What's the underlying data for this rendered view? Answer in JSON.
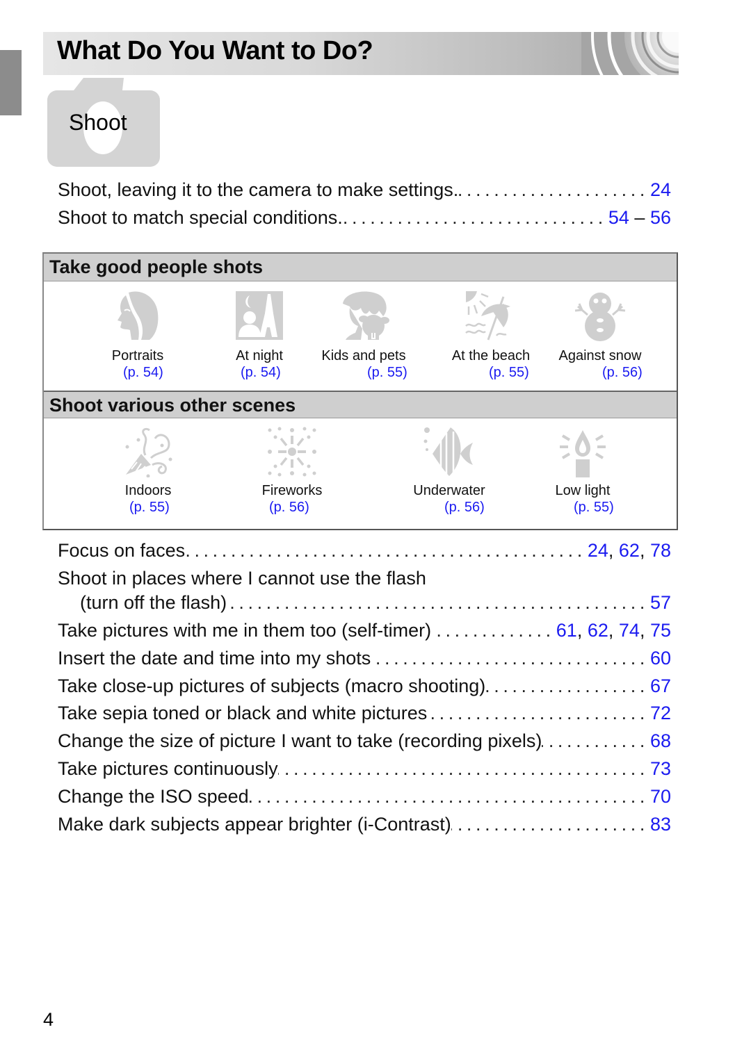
{
  "page": {
    "title": "What Do You Want to Do?",
    "section_label": "Shoot",
    "page_number": "4",
    "link_color": "#1a1af0",
    "header_gray": "#cfcfcf"
  },
  "intro_items": [
    {
      "label": "Shoot, leaving it to the camera to make settings.",
      "pages": [
        "24"
      ],
      "separator": ""
    },
    {
      "label": "Shoot to match special conditions.",
      "pages": [
        "54",
        "56"
      ],
      "separator": " – "
    }
  ],
  "people_shots": {
    "heading": "Take good people shots",
    "items": [
      {
        "name": "Portraits",
        "page": "(p. 54)",
        "icon": "portrait-icon"
      },
      {
        "name": "At night",
        "page": "(p. 54)",
        "icon": "night-scene-icon"
      },
      {
        "name": "Kids and pets",
        "page": "(p. 55)",
        "icon": "kids-pets-icon"
      },
      {
        "name": "At the beach",
        "page": "(p. 55)",
        "icon": "beach-icon"
      },
      {
        "name": "Against snow",
        "page": "(p. 56)",
        "icon": "snowman-icon"
      }
    ]
  },
  "other_scenes": {
    "heading": "Shoot various other scenes",
    "items": [
      {
        "name": "Indoors",
        "page": "(p. 55)",
        "icon": "party-indoors-icon"
      },
      {
        "name": "Fireworks",
        "page": "(p. 56)",
        "icon": "fireworks-icon"
      },
      {
        "name": "Underwater",
        "page": "(p. 56)",
        "icon": "fish-underwater-icon"
      },
      {
        "name": "Low light",
        "page": "(p. 55)",
        "icon": "candle-low-light-icon"
      }
    ]
  },
  "feature_items": [
    {
      "label": "Focus on faces",
      "pages": [
        "24",
        "62",
        "78"
      ]
    },
    {
      "label": "Shoot in places where I cannot use the flash",
      "continuation": "(turn off the flash)",
      "pages": [
        "57"
      ]
    },
    {
      "label": "Take pictures with me in them too (self-timer)",
      "pages": [
        "61",
        "62",
        "74",
        "75"
      ]
    },
    {
      "label": "Insert the date and time into my shots",
      "pages": [
        "60"
      ]
    },
    {
      "label": "Take close-up pictures of subjects (macro shooting)",
      "pages": [
        "67"
      ]
    },
    {
      "label": "Take sepia toned or black and white pictures",
      "pages": [
        "72"
      ]
    },
    {
      "label": "Change the size of picture I want to take (recording pixels)",
      "pages": [
        "68"
      ]
    },
    {
      "label": "Take pictures continuously",
      "pages": [
        "73"
      ]
    },
    {
      "label": "Change the ISO speed",
      "pages": [
        "70"
      ]
    },
    {
      "label": "Make dark subjects appear brighter (i-Contrast)",
      "pages": [
        "83"
      ]
    }
  ]
}
